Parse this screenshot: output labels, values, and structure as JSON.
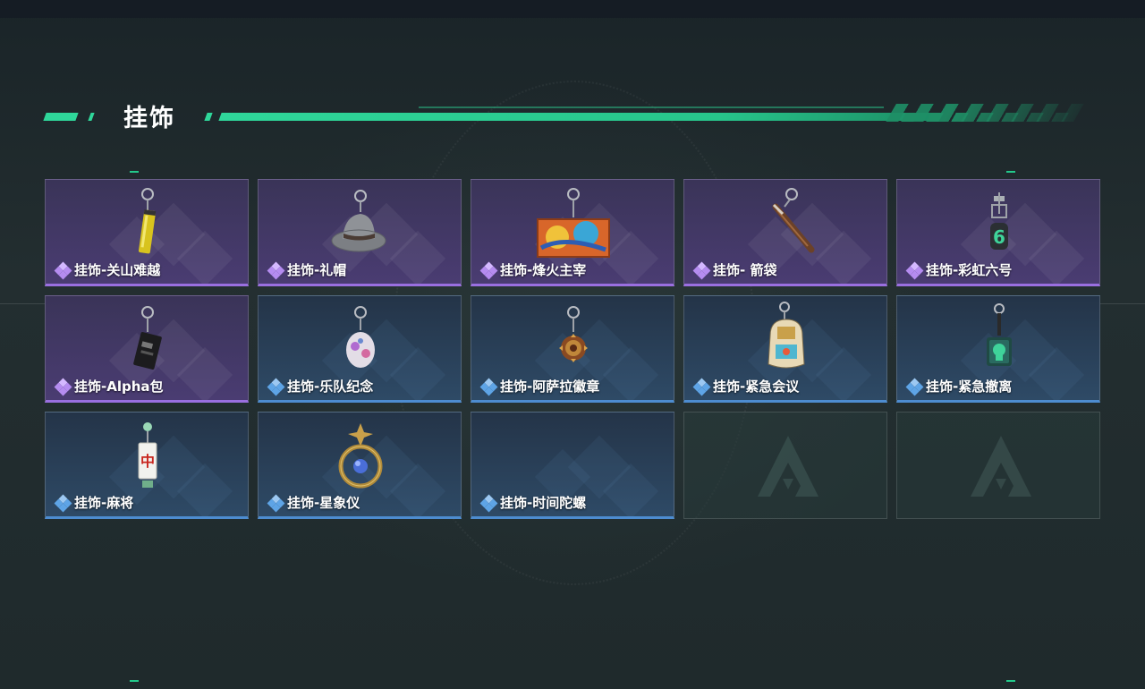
{
  "section": {
    "title": "挂饰",
    "accent_color": "#2fd79a"
  },
  "rarity_colors": {
    "purple": "#9a6fe0",
    "blue": "#4d8cd0"
  },
  "items": [
    {
      "label": "挂饰-关山难越",
      "rarity": "purple",
      "icon": "yellow-cylinder-keychain-icon"
    },
    {
      "label": "挂饰-礼帽",
      "rarity": "purple",
      "icon": "fedora-hat-keychain-icon"
    },
    {
      "label": "挂饰-烽火主宰",
      "rarity": "purple",
      "icon": "graffiti-plate-keychain-icon"
    },
    {
      "label": "挂饰- 箭袋",
      "rarity": "purple",
      "icon": "quiver-keychain-icon"
    },
    {
      "label": "挂饰-彩虹六号",
      "rarity": "purple",
      "icon": "rainbow-six-keychain-icon"
    },
    {
      "label": "挂饰-Alpha包",
      "rarity": "purple",
      "icon": "alpha-bag-keychain-icon"
    },
    {
      "label": "挂饰-乐队纪念",
      "rarity": "blue",
      "icon": "band-badge-keychain-icon"
    },
    {
      "label": "挂饰-阿萨拉徽章",
      "rarity": "blue",
      "icon": "asala-emblem-keychain-icon"
    },
    {
      "label": "挂饰-紧急会议",
      "rarity": "blue",
      "icon": "emergency-meeting-keychain-icon"
    },
    {
      "label": "挂饰-紧急撤离",
      "rarity": "blue",
      "icon": "emergency-evac-keychain-icon"
    },
    {
      "label": "挂饰-麻将",
      "rarity": "blue",
      "icon": "mahjong-tile-keychain-icon"
    },
    {
      "label": "挂饰-星象仪",
      "rarity": "blue",
      "icon": "astrolabe-keychain-icon"
    },
    {
      "label": "挂饰-时间陀螺",
      "rarity": "blue",
      "icon": "time-spinner-keychain-icon"
    }
  ],
  "empty_slots": [
    {
      "icon": "delta-logo-placeholder-icon"
    },
    {
      "icon": "delta-logo-placeholder-icon"
    }
  ]
}
